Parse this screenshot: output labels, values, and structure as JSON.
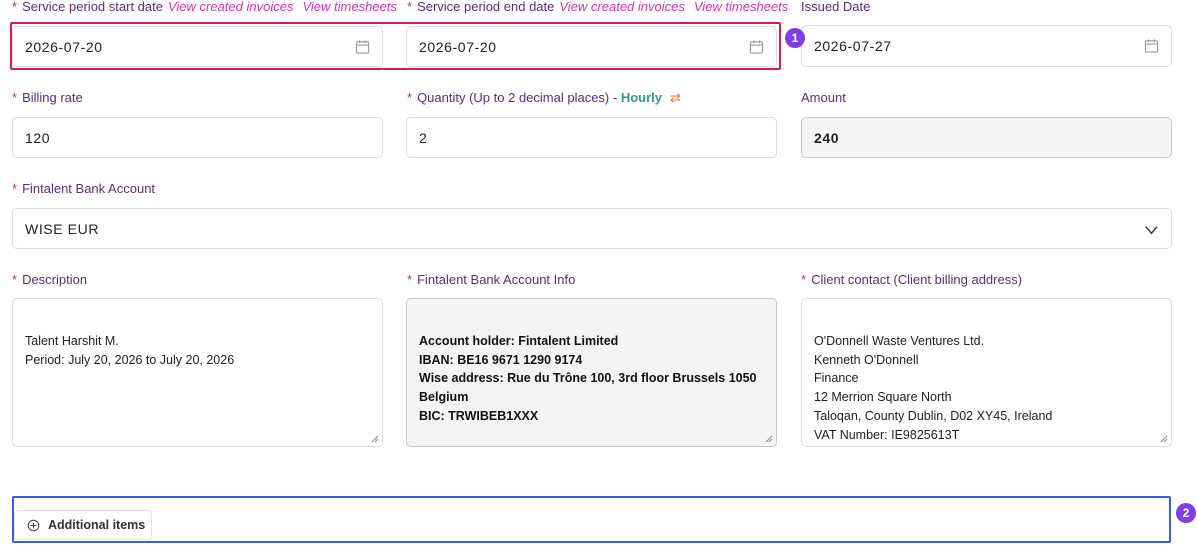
{
  "row1": {
    "start": {
      "required": "*",
      "label": "Service period start date",
      "link1": "View created invoices",
      "link2": "View timesheets",
      "value": "2026-07-20",
      "icon": "calendar-icon"
    },
    "end": {
      "required": "*",
      "label": "Service period end date",
      "link1": "View created invoices",
      "link2": "View timesheets",
      "value": "2026-07-20",
      "icon": "calendar-icon"
    },
    "issued": {
      "label": "Issued Date",
      "value": "2026-07-27",
      "icon": "calendar-icon"
    }
  },
  "row2": {
    "rate": {
      "required": "*",
      "label": "Billing rate",
      "value": "120"
    },
    "qty": {
      "required": "*",
      "label": "Quantity (Up to 2 decimal places) -",
      "unit": "Hourly",
      "value": "2",
      "icon": "swap-icon"
    },
    "amount": {
      "label": "Amount",
      "value": "240"
    }
  },
  "bank": {
    "required": "*",
    "label": "Fintalent Bank Account",
    "value": "WISE EUR",
    "icon": "chevron-down-icon"
  },
  "row4": {
    "description": {
      "required": "*",
      "label": "Description",
      "value": "Talent Harshit M.\nPeriod: July 20, 2026 to July 20, 2026"
    },
    "bankinfo": {
      "required": "*",
      "label": "Fintalent Bank Account Info",
      "value": "Account holder: Fintalent Limited\nIBAN: BE16 9671 1290 9174\nWise address: Rue du Trône 100, 3rd floor Brussels 1050\nBelgium\nBIC: TRWIBEB1XXX"
    },
    "client": {
      "required": "*",
      "label": "Client contact (Client billing address)",
      "value": "O'Donnell Waste Ventures Ltd.\nKenneth O'Donnell\nFinance\n12 Merrion Square North\nTaloqan, County Dublin, D02 XY45, Ireland\nVAT Number: IE9825613T"
    }
  },
  "additional": {
    "label": "Additional items",
    "icon": "plus-circle-icon"
  },
  "annotations": {
    "badge1": "1",
    "badge2": "2",
    "color_red": "#d21f4b",
    "color_blue": "#2f63d6",
    "color_badge": "#7b3fe4"
  }
}
